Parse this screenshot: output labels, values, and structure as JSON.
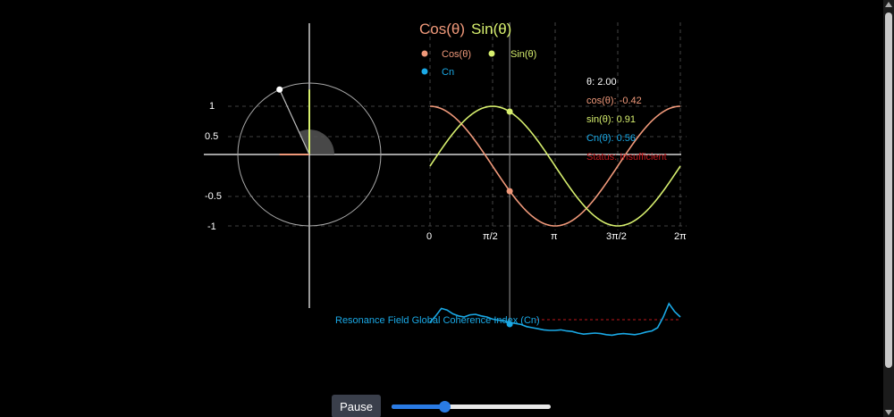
{
  "colors": {
    "cos": "#f0997a",
    "sin": "#d7ef6e",
    "cn": "#1aa9e6",
    "status": "#c0171b",
    "axis": "#ffffff",
    "grid": "#555555"
  },
  "legend": {
    "title_cos": "Cos(θ)",
    "title_sin": "Sin(θ)",
    "cos_label": "Cos(θ)",
    "sin_label": "Sin(θ)",
    "cn_label": "Cn"
  },
  "circle_axis_labels": [
    "1",
    "0.5",
    "-0.5",
    "-1"
  ],
  "wave_x_labels": [
    "0",
    "π/2",
    "π",
    "3π/2",
    "2π"
  ],
  "readout": {
    "theta": "θ: 2.00",
    "cos": "cos(θ): -0.42",
    "sin": "sin(θ): 0.91",
    "cn": "Cn(θ): 0.56",
    "status": "Status: Insufficient"
  },
  "chart_data": {
    "type": "line",
    "theta": 2.0,
    "x_range": [
      0,
      6.2832
    ],
    "y_range": [
      -1,
      1
    ],
    "series": [
      {
        "name": "Cos(θ)",
        "function": "cos"
      },
      {
        "name": "Sin(θ)",
        "function": "sin"
      }
    ],
    "points": {
      "cos": -0.42,
      "sin": 0.91,
      "cn": 0.56
    },
    "cn_series": [
      0.4,
      0.52,
      0.66,
      0.63,
      0.56,
      0.52,
      0.5,
      0.54,
      0.55,
      0.52,
      0.5,
      0.46,
      0.44,
      0.43,
      0.4,
      0.38,
      0.36,
      0.32,
      0.3,
      0.28,
      0.26,
      0.25,
      0.25,
      0.26,
      0.24,
      0.23,
      0.2,
      0.18,
      0.19,
      0.2,
      0.19,
      0.17,
      0.16,
      0.18,
      0.19,
      0.18,
      0.17,
      0.19,
      0.22,
      0.24,
      0.3,
      0.5,
      0.75,
      0.6,
      0.5
    ]
  },
  "cn_chart_label": "Resonance Field Global Coherence Index (Cn)",
  "controls": {
    "pause_label": "Pause",
    "speed": 0.33
  }
}
